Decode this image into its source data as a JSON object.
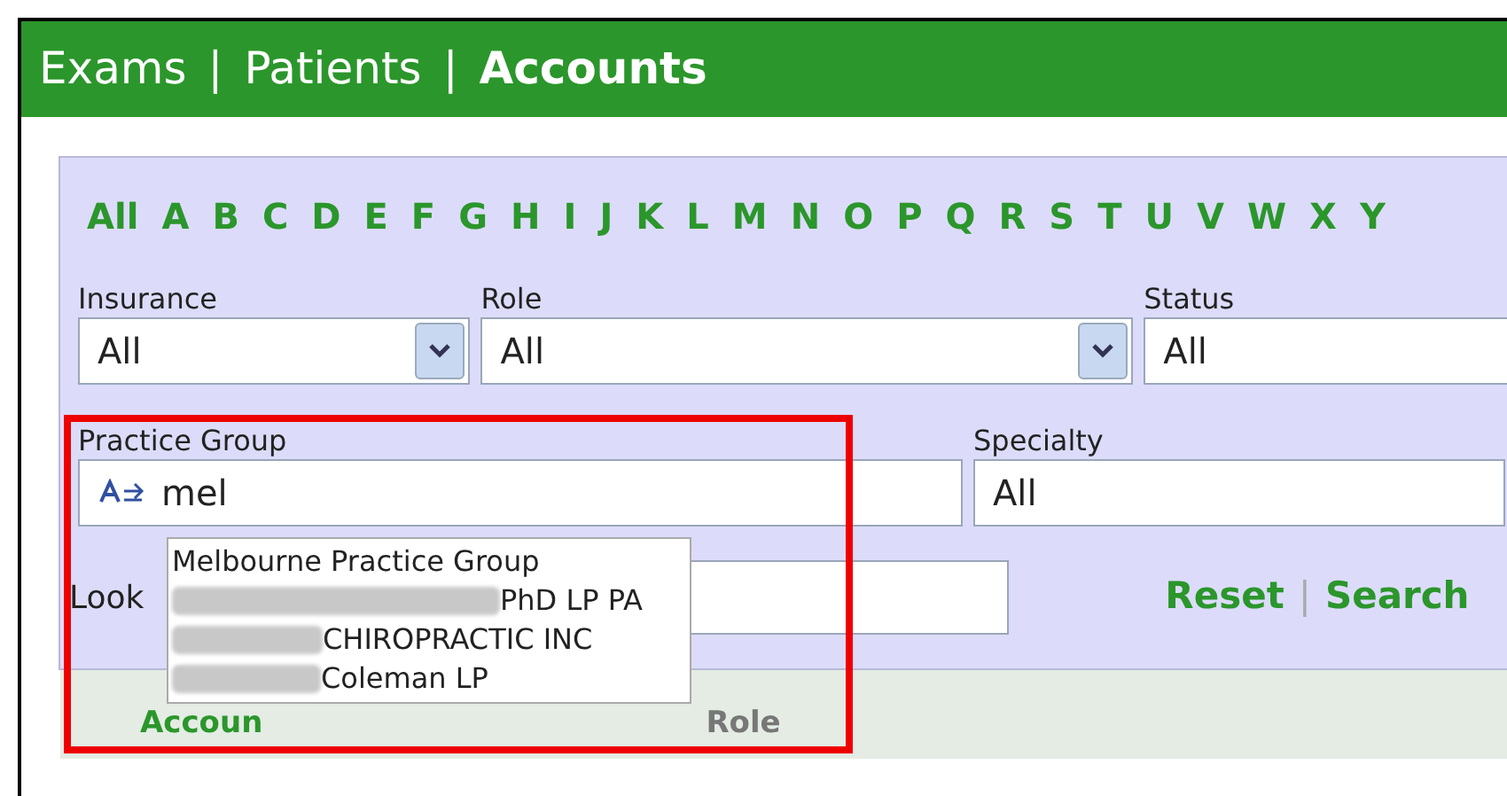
{
  "nav": [
    {
      "label": "Exams",
      "selected": false
    },
    {
      "label": "Patients",
      "selected": false
    },
    {
      "label": "Accounts",
      "selected": true
    }
  ],
  "nav_separator": "|",
  "letters": [
    "All",
    "A",
    "B",
    "C",
    "D",
    "E",
    "F",
    "G",
    "H",
    "I",
    "J",
    "K",
    "L",
    "M",
    "N",
    "O",
    "P",
    "Q",
    "R",
    "S",
    "T",
    "U",
    "V",
    "W",
    "X",
    "Y"
  ],
  "filters": [
    {
      "label": "Insurance",
      "value": "All",
      "kind": "select"
    },
    {
      "label": "Role",
      "value": "All",
      "kind": "select"
    },
    {
      "label": "Status",
      "value": "All",
      "kind": "select"
    }
  ],
  "practice_group": {
    "label": "Practice Group",
    "value": "mel"
  },
  "specialty": {
    "label": "Specialty",
    "value": "All"
  },
  "lookup": {
    "label": "Look"
  },
  "suggestions": [
    {
      "text": "Melbourne Practice Group",
      "redacted": false
    },
    {
      "text": "PhD LP PA",
      "redacted": true
    },
    {
      "text": "CHIROPRACTIC INC",
      "redacted": true
    },
    {
      "text": "Coleman LP",
      "redacted": true
    }
  ],
  "actions": {
    "reset": "Reset",
    "separator": "|",
    "search": "Search"
  },
  "table": {
    "columns": [
      "Accoun",
      "Role"
    ]
  }
}
